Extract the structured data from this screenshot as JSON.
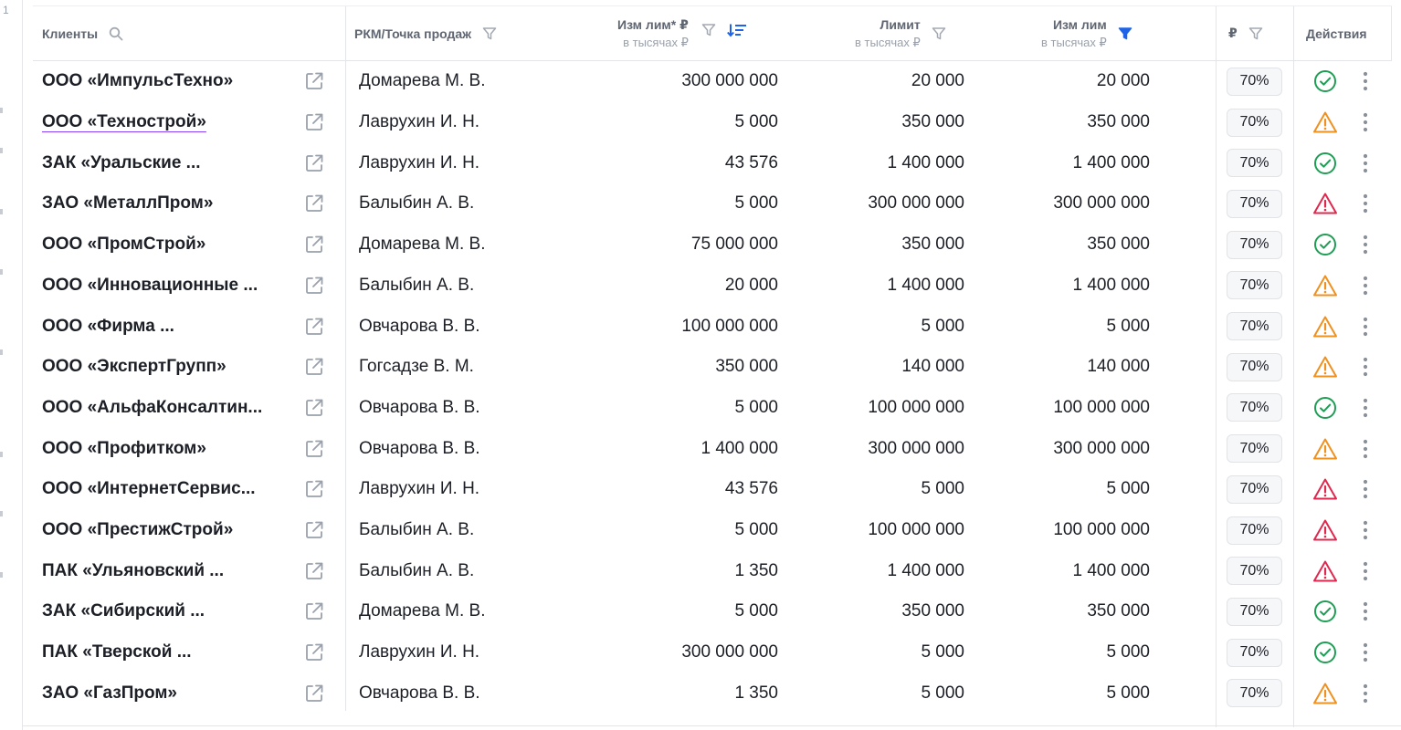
{
  "gutter": {
    "line_number": "1"
  },
  "header": {
    "clients": "Клиенты",
    "manager": "РКМ/Точка продаж",
    "izm_lim_star": "Изм лим* ₽",
    "izm_lim_star_sub": "в тысячах ₽",
    "limit": "Лимит",
    "limit_sub": "в тысячах ₽",
    "izm_lim": "Изм лим",
    "izm_lim_sub": "в тысячах ₽",
    "rub": "₽",
    "actions": "Действия"
  },
  "colors": {
    "ok": "#1f9d55",
    "warn": "#f0901e",
    "danger": "#e0284f",
    "active_filter": "#1e63e8",
    "muted_icon": "#a3a9b2"
  },
  "rows": [
    {
      "client": "ООО «ИмпульсТехно»",
      "manager": "Домарева М. В.",
      "izm_lim_star": "300 000 000",
      "limit": "20 000",
      "izm_lim": "20 000",
      "pct": "70%",
      "status": "ok"
    },
    {
      "client": "ООО «Технострой»",
      "manager": "Лаврухин И. Н.",
      "izm_lim_star": "5 000",
      "limit": "350 000",
      "izm_lim": "350 000",
      "pct": "70%",
      "status": "warn"
    },
    {
      "client": "ЗАК «Уральские ...",
      "manager": "Лаврухин И. Н.",
      "izm_lim_star": "43 576",
      "limit": "1 400 000",
      "izm_lim": "1 400 000",
      "pct": "70%",
      "status": "ok"
    },
    {
      "client": "ЗАО «МеталлПром»",
      "manager": "Балыбин А. В.",
      "izm_lim_star": "5 000",
      "limit": "300 000 000",
      "izm_lim": "300 000 000",
      "pct": "70%",
      "status": "danger"
    },
    {
      "client": "ООО «ПромСтрой»",
      "manager": "Домарева М. В.",
      "izm_lim_star": "75 000 000",
      "limit": "350 000",
      "izm_lim": "350 000",
      "pct": "70%",
      "status": "ok"
    },
    {
      "client": "ООО «Инновационные ...",
      "manager": "Балыбин А. В.",
      "izm_lim_star": "20 000",
      "limit": "1 400 000",
      "izm_lim": "1 400 000",
      "pct": "70%",
      "status": "warn"
    },
    {
      "client": "ООО «Фирма ...",
      "manager": "Овчарова В. В.",
      "izm_lim_star": "100 000 000",
      "limit": "5 000",
      "izm_lim": "5 000",
      "pct": "70%",
      "status": "warn"
    },
    {
      "client": "ООО «ЭкспертГрупп»",
      "manager": "Гогсадзе В. М.",
      "izm_lim_star": "350 000",
      "limit": "140 000",
      "izm_lim": "140 000",
      "pct": "70%",
      "status": "warn"
    },
    {
      "client": "ООО «АльфаКонсалтин...",
      "manager": "Овчарова В. В.",
      "izm_lim_star": "5 000",
      "limit": "100 000 000",
      "izm_lim": "100 000 000",
      "pct": "70%",
      "status": "ok"
    },
    {
      "client": "ООО «Профитком»",
      "manager": "Овчарова В. В.",
      "izm_lim_star": "1 400 000",
      "limit": "300 000 000",
      "izm_lim": "300 000 000",
      "pct": "70%",
      "status": "warn"
    },
    {
      "client": "ООО «ИнтернетСервис...",
      "manager": "Лаврухин И. Н.",
      "izm_lim_star": "43 576",
      "limit": "5 000",
      "izm_lim": "5 000",
      "pct": "70%",
      "status": "danger"
    },
    {
      "client": "ООО «ПрестижСтрой»",
      "manager": "Балыбин А. В.",
      "izm_lim_star": "5 000",
      "limit": "100 000 000",
      "izm_lim": "100 000 000",
      "pct": "70%",
      "status": "danger"
    },
    {
      "client": "ПАК «Ульяновский ...",
      "manager": "Балыбин А. В.",
      "izm_lim_star": "1 350",
      "limit": "1 400 000",
      "izm_lim": "1 400 000",
      "pct": "70%",
      "status": "danger"
    },
    {
      "client": "ЗАК «Сибирский ...",
      "manager": "Домарева М. В.",
      "izm_lim_star": "5 000",
      "limit": "350 000",
      "izm_lim": "350 000",
      "pct": "70%",
      "status": "ok"
    },
    {
      "client": "ПАК «Тверской ...",
      "manager": "Лаврухин И. Н.",
      "izm_lim_star": "300 000 000",
      "limit": "5 000",
      "izm_lim": "5 000",
      "pct": "70%",
      "status": "ok"
    },
    {
      "client": "ЗАО «ГазПром»",
      "manager": "Овчарова В. В.",
      "izm_lim_star": "1 350",
      "limit": "5 000",
      "izm_lim": "5 000",
      "pct": "70%",
      "status": "warn"
    }
  ]
}
